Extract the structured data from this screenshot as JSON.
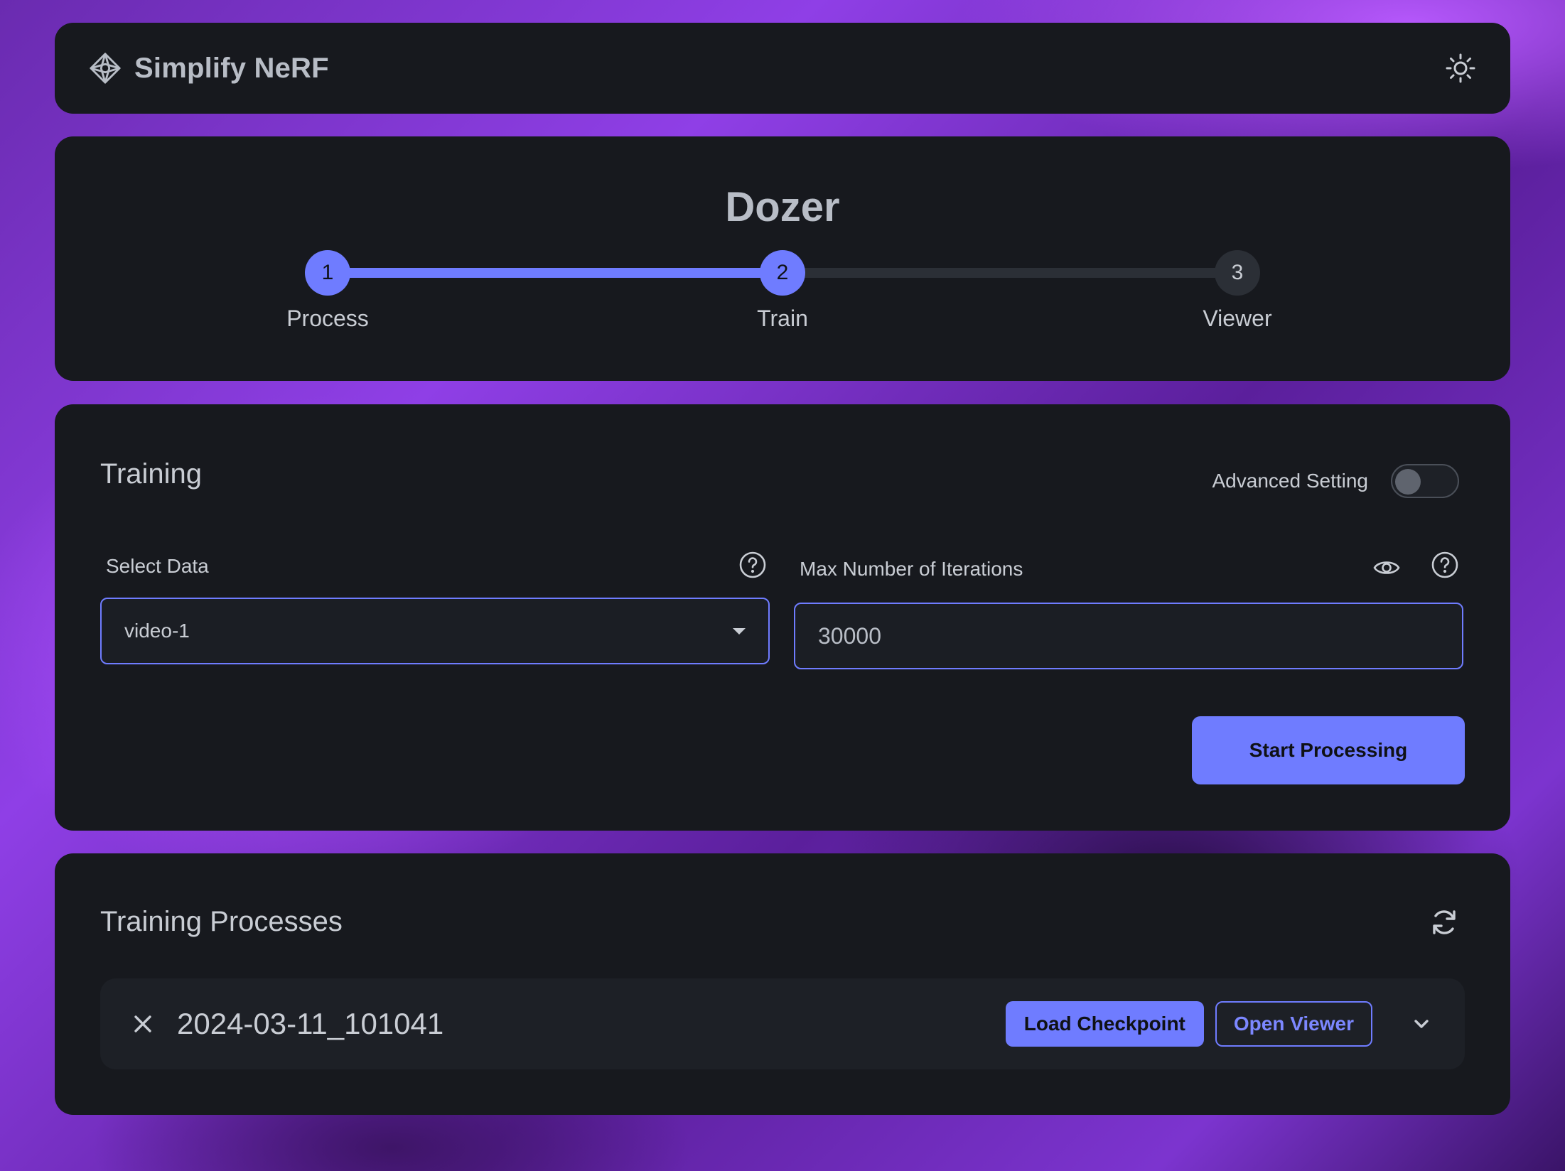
{
  "header": {
    "app_title": "Simplify NeRF",
    "logo_icon": "nerf-logo-icon",
    "theme_icon": "sun-icon"
  },
  "stepper": {
    "project_name": "Dozer",
    "steps": [
      {
        "number": "1",
        "label": "Process",
        "state": "complete"
      },
      {
        "number": "2",
        "label": "Train",
        "state": "active"
      },
      {
        "number": "3",
        "label": "Viewer",
        "state": "pending"
      }
    ],
    "accent_color": "#6f7cff"
  },
  "training": {
    "title": "Training",
    "advanced_setting_label": "Advanced Setting",
    "advanced_setting_on": false,
    "select_data": {
      "label": "Select Data",
      "value": "video-1"
    },
    "max_iterations": {
      "label": "Max Number of Iterations",
      "value": "30000"
    },
    "start_button": "Start Processing"
  },
  "processes": {
    "title": "Training Processes",
    "items": [
      {
        "name": "2024-03-11_101041",
        "load_button": "Load Checkpoint",
        "open_button": "Open Viewer"
      }
    ]
  }
}
